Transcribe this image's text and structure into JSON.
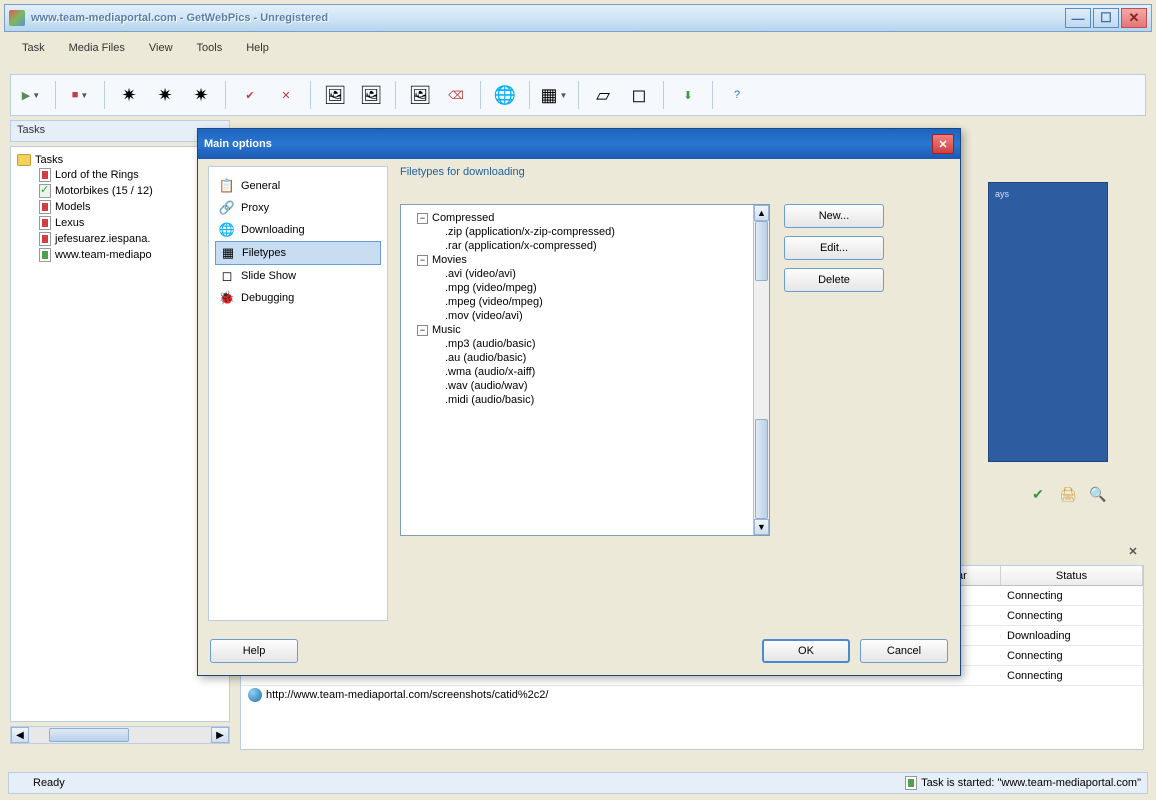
{
  "window": {
    "title": "www.team-mediaportal.com - GetWebPics - Unregistered"
  },
  "menu": [
    "Task",
    "Media Files",
    "View",
    "Tools",
    "Help"
  ],
  "tasks_pane": {
    "header": "Tasks",
    "root": "Tasks",
    "items": [
      "Lord of the Rings",
      "Motorbikes (15 / 12)",
      "Models",
      "Lexus",
      "jefesuarez.iespana.",
      "www.team-mediapo"
    ]
  },
  "table": {
    "col_ar": "ar",
    "col_status": "Status",
    "rows": [
      "Connecting",
      "Connecting",
      "Downloading",
      "Connecting",
      "Connecting"
    ]
  },
  "url": "http://www.team-mediaportal.com/screenshots/catid%2c2/",
  "statusbar": {
    "ready": "Ready",
    "task_started": "Task is started: \"www.team-mediaportal.com\""
  },
  "blue_panel": {
    "text": "ays"
  },
  "dialog": {
    "title": "Main options",
    "side": [
      "General",
      "Proxy",
      "Downloading",
      "Filetypes",
      "Slide Show",
      "Debugging"
    ],
    "selected_side": "Filetypes",
    "section_title": "Filetypes for downloading",
    "categories": [
      {
        "name": "Compressed",
        "exts": [
          ".zip (application/x-zip-compressed)",
          ".rar (application/x-compressed)"
        ]
      },
      {
        "name": "Movies",
        "exts": [
          ".avi (video/avi)",
          ".mpg (video/mpeg)",
          ".mpeg (video/mpeg)",
          ".mov (video/avi)"
        ]
      },
      {
        "name": "Music",
        "exts": [
          ".mp3 (audio/basic)",
          ".au (audio/basic)",
          ".wma (audio/x-aiff)",
          ".wav (audio/wav)",
          ".midi (audio/basic)"
        ]
      }
    ],
    "buttons": {
      "new": "New...",
      "edit": "Edit...",
      "delete": "Delete",
      "help": "Help",
      "ok": "OK",
      "cancel": "Cancel"
    }
  }
}
